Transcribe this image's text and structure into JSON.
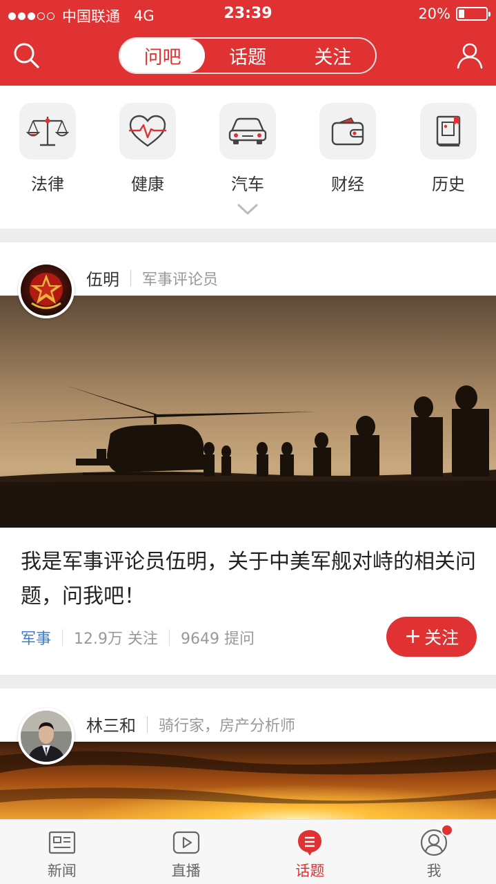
{
  "status_bar": {
    "carrier": "中国联通",
    "network": "4G",
    "time": "23:39",
    "battery": "20%",
    "battery_level": 0.2
  },
  "header": {
    "tabs": [
      {
        "label": "问吧",
        "active": true
      },
      {
        "label": "话题",
        "active": false
      },
      {
        "label": "关注",
        "active": false
      }
    ],
    "search_icon": "search-icon",
    "user_icon": "user-icon"
  },
  "categories": [
    {
      "label": "法律",
      "icon": "scales-icon"
    },
    {
      "label": "健康",
      "icon": "heartbeat-icon"
    },
    {
      "label": "汽车",
      "icon": "car-icon"
    },
    {
      "label": "财经",
      "icon": "wallet-icon"
    },
    {
      "label": "历史",
      "icon": "book-icon"
    }
  ],
  "feed": [
    {
      "author": "伍明",
      "role": "军事评论员",
      "title": "我是军事评论员伍明，关于中美军舰对峙的相关问题，问我吧！",
      "tag": "军事",
      "followers": "12.9万 关注",
      "questions": "9649 提问",
      "follow_label": "关注",
      "follow_icon": "plus-icon"
    },
    {
      "author": "林三和",
      "role": "骑行家，房产分析师"
    }
  ],
  "tabbar": [
    {
      "label": "新闻",
      "icon": "news-icon",
      "active": false
    },
    {
      "label": "直播",
      "icon": "play-icon",
      "active": false
    },
    {
      "label": "话题",
      "icon": "topic-chat-icon",
      "active": true
    },
    {
      "label": "我",
      "icon": "profile-icon",
      "active": false
    }
  ],
  "colors": {
    "brand_red": "#e03232",
    "tag_blue": "#3f7bc6",
    "page_bg": "#ededed"
  }
}
